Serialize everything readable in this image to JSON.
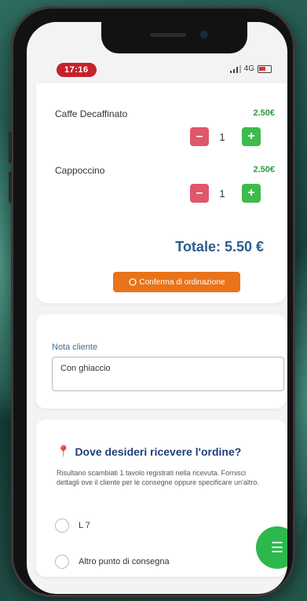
{
  "status_bar": {
    "time": "17:16",
    "network": "4G"
  },
  "order": {
    "items": [
      {
        "name": "Caffe Decaffinato",
        "price": "2.50€",
        "qty": "1"
      },
      {
        "name": "Cappoccino",
        "price": "2.50€",
        "qty": "1"
      }
    ],
    "total": "Totale: 5.50 €",
    "confirm_label": "Conferma di ordinazione"
  },
  "note": {
    "label": "Nota cliente",
    "value": "Con ghiaccio"
  },
  "delivery": {
    "title": "Dove desideri ricevere l'ordine?",
    "description": "Risultano scambiati 1 tavolo registrati nella ricevuta. Fornisci dettagli ove il cliente per le consegne oppure specificare un'altro.",
    "options": [
      "L 7",
      "Altro punto di consegna"
    ]
  },
  "colors": {
    "accent": "#c5222b",
    "price_green": "#2e9a3f",
    "total_blue": "#2a5d8e",
    "confirm_orange": "#e8731a"
  }
}
